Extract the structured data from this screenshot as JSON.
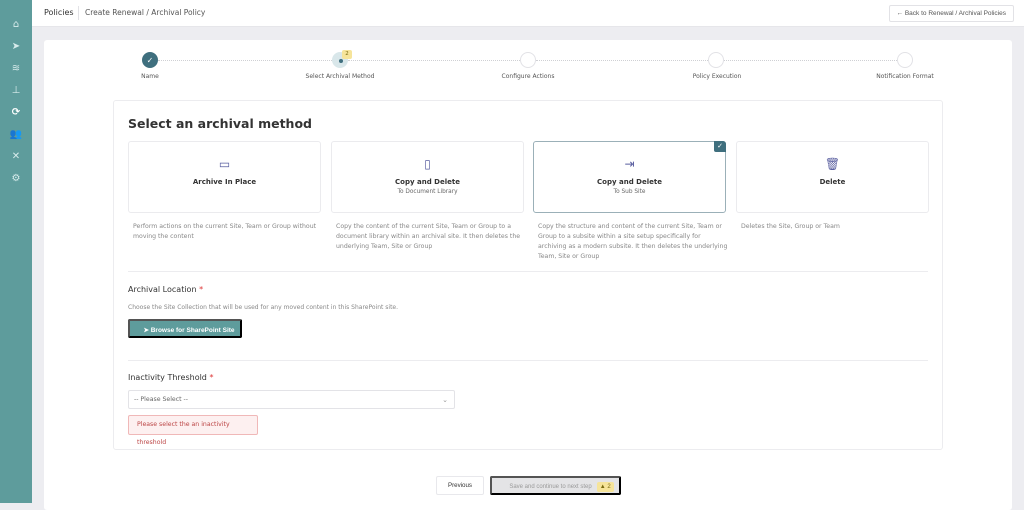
{
  "sidebar": {
    "items": [
      {
        "icon": "home-icon",
        "glyph": "⌂"
      },
      {
        "icon": "send-icon",
        "glyph": "➤"
      },
      {
        "icon": "layers-icon",
        "glyph": "≋"
      },
      {
        "icon": "sitemap-icon",
        "glyph": "⊥"
      },
      {
        "icon": "sync-icon",
        "glyph": "⟳",
        "active": true
      },
      {
        "icon": "users-icon",
        "glyph": "👥"
      },
      {
        "icon": "tools-icon",
        "glyph": "✕"
      },
      {
        "icon": "gear-icon",
        "glyph": "⚙"
      }
    ]
  },
  "header": {
    "title": "Policies",
    "breadcrumb": "Create Renewal / Archival Policy",
    "back_label": "← Back to Renewal / Archival Policies"
  },
  "stepper": {
    "steps": [
      {
        "label": "Name",
        "state": "done"
      },
      {
        "label": "Select Archival Method",
        "state": "current",
        "badge": "2"
      },
      {
        "label": "Configure Actions",
        "state": "pending"
      },
      {
        "label": "Policy Execution",
        "state": "pending"
      },
      {
        "label": "Notification Format",
        "state": "pending"
      }
    ]
  },
  "form": {
    "title": "Select an archival method",
    "options": [
      {
        "icon": "archive-box-icon",
        "glyph": "▭",
        "name": "Archive In Place",
        "sub": "",
        "desc": "Perform actions on the current Site, Team or Group without moving the content",
        "selected": false
      },
      {
        "icon": "document-library-icon",
        "glyph": "▯",
        "name": "Copy and Delete",
        "sub": "To Document Library",
        "desc": "Copy the content of the current Site, Team or Group to a document library within an archival site. It then deletes the underlying Team, Site or Group",
        "selected": false
      },
      {
        "icon": "move-to-subsite-icon",
        "glyph": "⇥",
        "name": "Copy and Delete",
        "sub": "To Sub Site",
        "desc": "Copy the structure and content of the current Site, Team or Group to a subsite within a site setup specifically for archiving as a modern subsite. It then deletes the underlying Team, Site or Group",
        "selected": true
      },
      {
        "icon": "trash-icon",
        "glyph": "🗑",
        "name": "Delete",
        "sub": "",
        "desc": "Deletes the Site, Group or Team",
        "selected": false
      }
    ],
    "archival_location": {
      "label": "Archival Location",
      "required": "*",
      "help": "Choose the Site Collection that will be used for any moved content in this SharePoint site.",
      "browse_label": "Browse for SharePoint Site"
    },
    "inactivity": {
      "label": "Inactivity Threshold",
      "required": "*",
      "placeholder": "-- Please Select --",
      "error": "Please select the an inactivity threshold"
    }
  },
  "footer": {
    "previous": "Previous",
    "next": "Save and continue to next step",
    "warning_count": "▲ 2"
  },
  "colors": {
    "sidebar": "#5e9c9c",
    "accent": "#3f6f7e",
    "error": "#b44444",
    "warning": "#f6e49a"
  }
}
